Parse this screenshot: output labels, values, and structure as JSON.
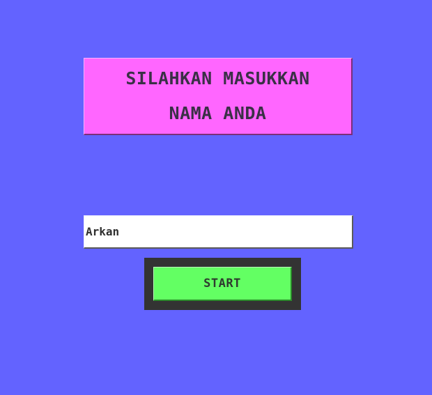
{
  "prompt": {
    "line1": "SILAHKAN MASUKKAN",
    "line2": "NAMA ANDA"
  },
  "name_input": {
    "value": "Arkan"
  },
  "start_button": {
    "label": "START"
  },
  "colors": {
    "background": "#6363ff",
    "title_box": "#ff66ff",
    "input_bg": "#ffffff",
    "button_frame": "#333333",
    "button": "#63ff63",
    "text": "#3a3046"
  }
}
